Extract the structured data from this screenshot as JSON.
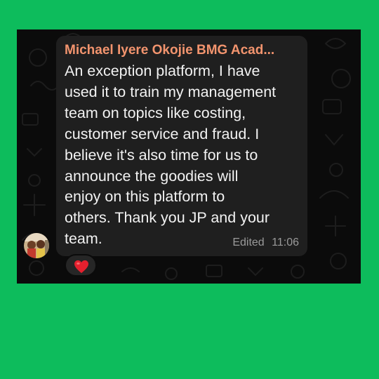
{
  "message": {
    "sender": "Michael Iyere Okojie BMG Acad...",
    "lines": [
      "An exception platform, I have",
      "used it to train my management",
      "team on topics like costing,",
      "customer service and fraud. I",
      "believe it's also time for us to",
      "announce the goodies will",
      "enjoy on this platform to",
      "others. Thank you JP and your",
      "team."
    ],
    "edited_label": "Edited",
    "time": "11:06",
    "reaction": "heart-emoji"
  },
  "colors": {
    "background": "#0dbc5c",
    "chat_bg": "#0b0b0b",
    "bubble": "#1f1f1f",
    "sender": "#f2946e",
    "text": "#f2f2f2",
    "meta": "#9a9a9a",
    "heart": "#e5202e"
  }
}
